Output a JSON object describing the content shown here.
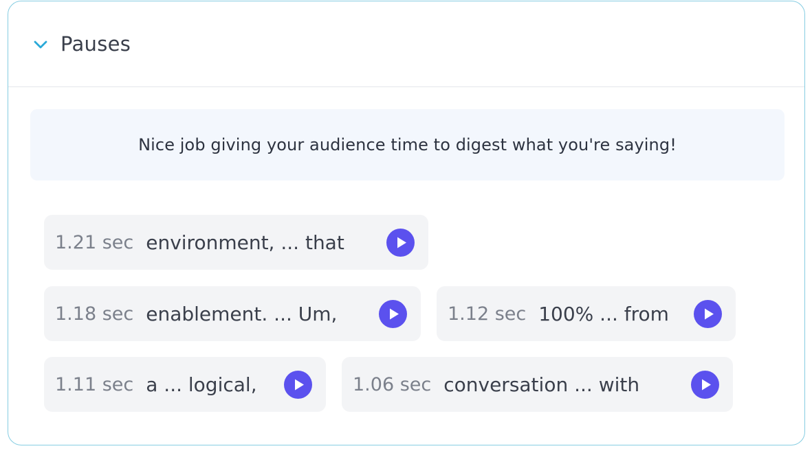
{
  "section": {
    "title": "Pauses",
    "expanded_icon": "chevron-down-icon",
    "accent_color": "#29a9d8"
  },
  "banner": {
    "message": "Nice job giving your audience time to digest what you're saying!"
  },
  "pauses": [
    {
      "duration": "1.21 sec",
      "context": "environment, ... that"
    },
    {
      "duration": "1.18 sec",
      "context": "enablement. ... Um,"
    },
    {
      "duration": "1.12 sec",
      "context": "100% ... from"
    },
    {
      "duration": "1.11 sec",
      "context": "a ... logical,"
    },
    {
      "duration": "1.06 sec",
      "context": "conversation ... with"
    }
  ],
  "colors": {
    "play_button": "#5b51ee",
    "card_border": "#86cde2",
    "pill_bg": "#f3f4f6",
    "banner_bg": "#f3f7fd"
  }
}
